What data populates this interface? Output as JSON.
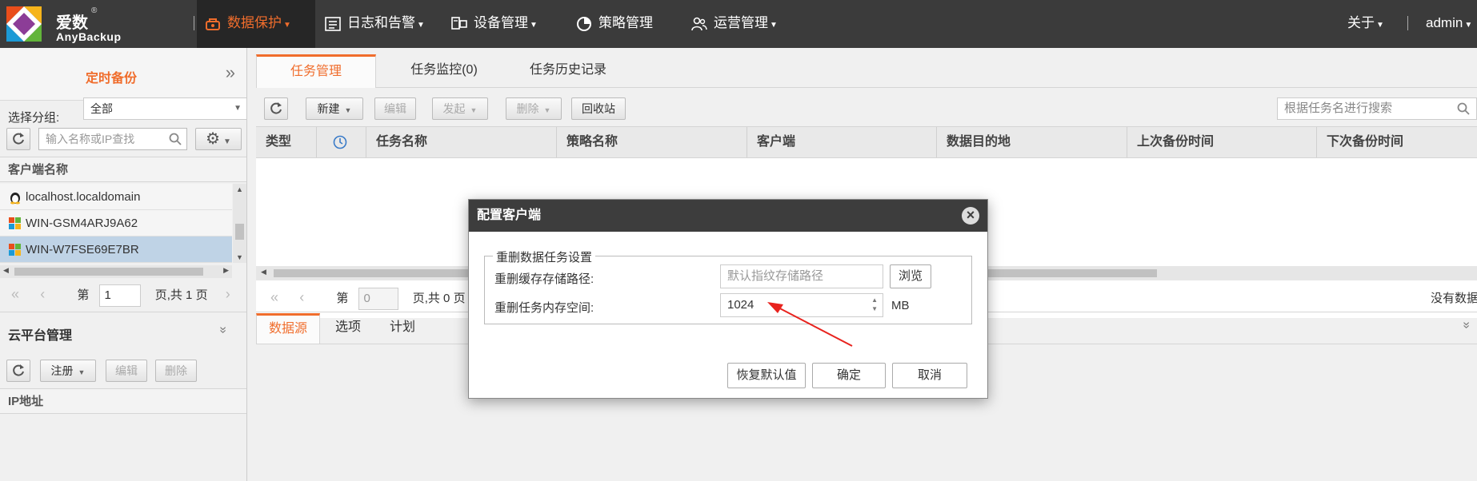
{
  "brand": {
    "cn": "爱数",
    "reg": "®",
    "en": "AnyBackup"
  },
  "nav": {
    "items": [
      {
        "label": "数据保护",
        "icon": "backup-icon"
      },
      {
        "label": "日志和告警",
        "icon": "log-icon"
      },
      {
        "label": "设备管理",
        "icon": "device-icon"
      },
      {
        "label": "策略管理",
        "icon": "policy-icon"
      },
      {
        "label": "运营管理",
        "icon": "users-icon"
      }
    ],
    "about": "关于",
    "user": "admin"
  },
  "left": {
    "title": "定时备份",
    "group_label": "选择分组:",
    "group_value": "全部",
    "search_placeholder": "输入名称或IP查找",
    "client_header": "客户端名称",
    "clients": [
      {
        "name": "localhost.localdomain",
        "os": "linux"
      },
      {
        "name": "WIN-GSM4ARJ9A62",
        "os": "windows"
      },
      {
        "name": "WIN-W7FSE69E7BR",
        "os": "windows",
        "selected": true
      }
    ],
    "pager": {
      "prefix": "第",
      "page": "1",
      "suffix": "页,共 1 页"
    },
    "cloud_title": "云平台管理",
    "cloud_buttons": {
      "register": "注册",
      "edit": "编辑",
      "delete": "删除"
    },
    "ip_header": "IP地址"
  },
  "main": {
    "tabs": [
      "任务管理",
      "任务监控(0)",
      "任务历史记录"
    ],
    "toolbar": {
      "new": "新建",
      "edit": "编辑",
      "start": "发起",
      "delete": "删除",
      "recycle": "回收站"
    },
    "search_placeholder": "根据任务名进行搜索",
    "columns": [
      "类型",
      "",
      "任务名称",
      "策略名称",
      "客户端",
      "数据目的地",
      "上次备份时间",
      "下次备份时间"
    ],
    "pager": {
      "prefix": "第",
      "page": "0",
      "suffix": "页,共 0 页"
    },
    "no_data": "没有数据",
    "bottom_tabs": [
      "数据源",
      "选项",
      "计划"
    ]
  },
  "dialog": {
    "title": "配置客户端",
    "fieldset_legend": "重删数据任务设置",
    "cache_label": "重删缓存存储路径:",
    "cache_placeholder": "默认指纹存储路径",
    "browse": "浏览",
    "memory_label": "重删任务内存空间:",
    "memory_value": "1024",
    "memory_unit": "MB",
    "buttons": {
      "restore": "恢复默认值",
      "ok": "确定",
      "cancel": "取消"
    }
  },
  "colors": {
    "accent": "#f06d2c",
    "topbar": "#3b3b3b",
    "dialog_title": "#3d3d3d",
    "annotation_arrow": "#e8231e"
  }
}
